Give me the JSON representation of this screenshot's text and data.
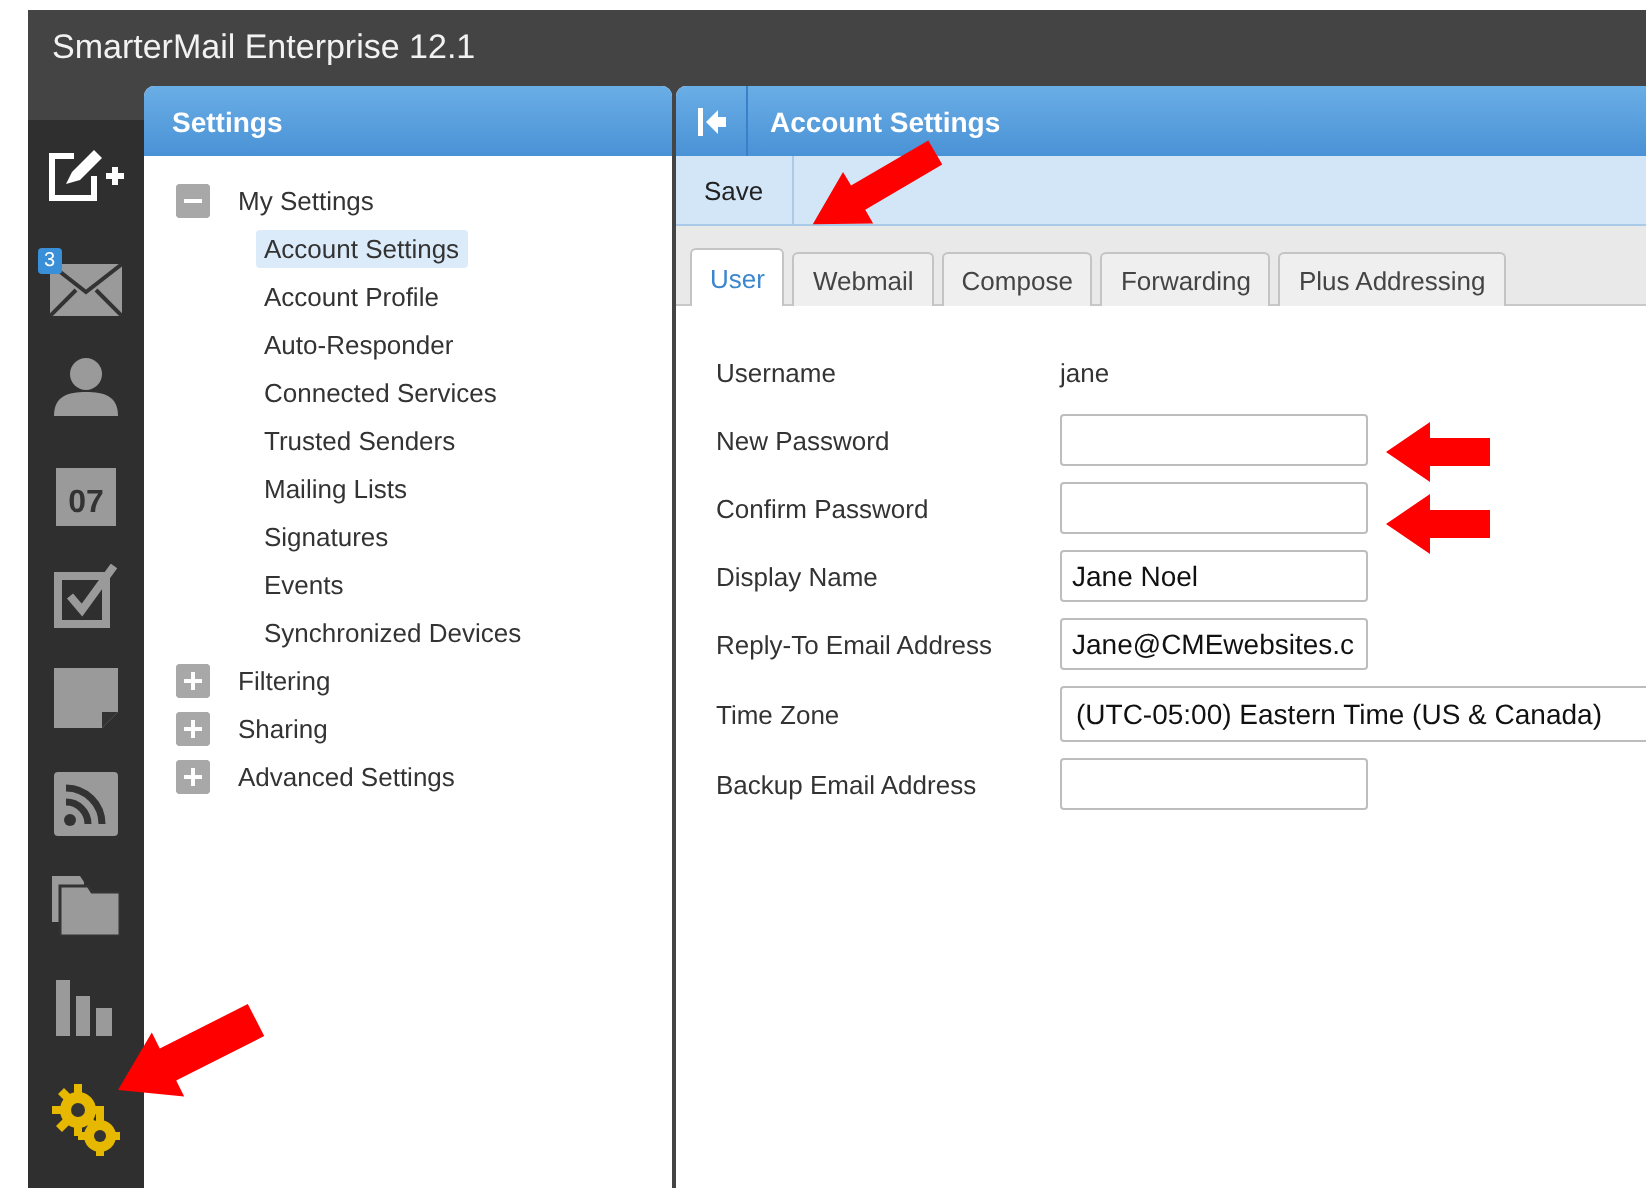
{
  "window": {
    "title": "SmarterMail Enterprise 12.1"
  },
  "rail": {
    "items": [
      {
        "kind": "compose",
        "selected": false
      },
      {
        "kind": "mail",
        "selected": false,
        "badge": "3"
      },
      {
        "kind": "contacts",
        "selected": false
      },
      {
        "kind": "calendar",
        "selected": false,
        "day": "07"
      },
      {
        "kind": "tasks",
        "selected": false
      },
      {
        "kind": "notes",
        "selected": false
      },
      {
        "kind": "feeds",
        "selected": false
      },
      {
        "kind": "files",
        "selected": false
      },
      {
        "kind": "reports",
        "selected": false
      },
      {
        "kind": "settings",
        "selected": true
      }
    ]
  },
  "sidebar": {
    "title": "Settings",
    "tree": [
      {
        "label": "My Settings",
        "expanded": true,
        "selected": false,
        "children": [
          {
            "label": "Account Settings",
            "selected": true
          },
          {
            "label": "Account Profile",
            "selected": false
          },
          {
            "label": "Auto-Responder",
            "selected": false
          },
          {
            "label": "Connected Services",
            "selected": false
          },
          {
            "label": "Trusted Senders",
            "selected": false
          },
          {
            "label": "Mailing Lists",
            "selected": false
          },
          {
            "label": "Signatures",
            "selected": false
          },
          {
            "label": "Events",
            "selected": false
          },
          {
            "label": "Synchronized Devices",
            "selected": false
          }
        ]
      },
      {
        "label": "Filtering",
        "expanded": false,
        "selected": false
      },
      {
        "label": "Sharing",
        "expanded": false,
        "selected": false
      },
      {
        "label": "Advanced Settings",
        "expanded": false,
        "selected": false
      }
    ]
  },
  "main": {
    "title": "Account Settings",
    "toolbar": [
      "Save"
    ],
    "tabs": [
      {
        "label": "User",
        "selected": true
      },
      {
        "label": "Webmail",
        "selected": false
      },
      {
        "label": "Compose",
        "selected": false
      },
      {
        "label": "Forwarding",
        "selected": false
      },
      {
        "label": "Plus Addressing",
        "selected": false
      }
    ],
    "fields": [
      {
        "label": "Username",
        "kind": "static",
        "value": "jane"
      },
      {
        "label": "New Password",
        "kind": "input"
      },
      {
        "label": "Confirm Password",
        "kind": "input"
      },
      {
        "label": "Display Name",
        "kind": "input",
        "value": "Jane Noel"
      },
      {
        "label": "Reply-To Email Address",
        "kind": "input",
        "value": "Jane@CMEwebsites.c"
      },
      {
        "label": "Time Zone",
        "kind": "select",
        "value": "(UTC-05:00) Eastern Time (US & Canada)"
      },
      {
        "label": "Backup Email Address",
        "kind": "input"
      }
    ]
  }
}
